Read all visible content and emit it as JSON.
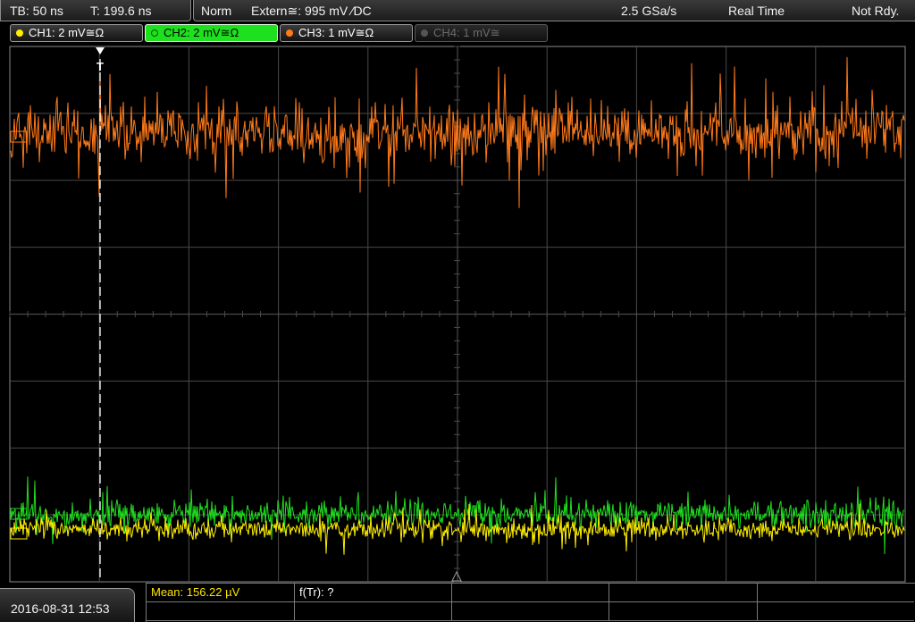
{
  "timebase": {
    "tb_label": "TB: 50 ns",
    "trigger_time": "T: 199.6 ns"
  },
  "acquisition": {
    "trigger_mode": "Norm",
    "trigger_source": "Extern≅: 995 mV ⁄DC",
    "sample_rate": "2.5 GSa/s",
    "mode": "Real Time",
    "status": "Not Rdy."
  },
  "channels": [
    {
      "label": "CH1: 2 mV≅Ω",
      "color": "#ffee00",
      "active": true
    },
    {
      "label": "CH2: 2 mV≅Ω",
      "color": "#22e022",
      "active": true,
      "selected": true
    },
    {
      "label": "CH3: 1 mV≅Ω",
      "color": "#ff7a1a",
      "active": true
    },
    {
      "label": "CH4: 1 mV≅",
      "color": "#5a5a5a",
      "active": false
    }
  ],
  "display": {
    "trigger_marker": "T",
    "grid_color": "#4a4a4a",
    "traces": {
      "ch3_color": "#ff7a1a",
      "ch2_color": "#1ee01e",
      "ch1_color": "#ffee00"
    }
  },
  "measurements": {
    "mean": "Mean: 156.22 µV",
    "rise_freq": "f(Tr): ?"
  },
  "datetime": "2016-08-31 12:53"
}
